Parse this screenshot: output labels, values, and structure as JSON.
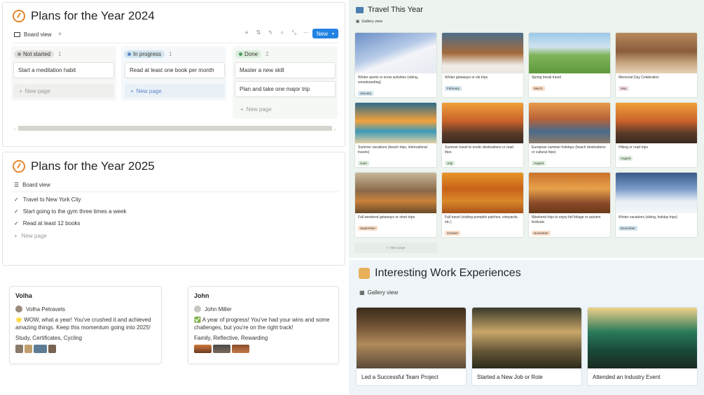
{
  "plans2024": {
    "title": "Plans for the Year 2024",
    "view_label": "Board view",
    "new_label": "New",
    "columns": [
      {
        "status": "Not started",
        "count": "1",
        "cards": [
          "Start a meditation habit"
        ],
        "new_page": "New page"
      },
      {
        "status": "In progress",
        "count": "1",
        "cards": [
          "Read at least one book per month"
        ],
        "new_page": "New page"
      },
      {
        "status": "Done",
        "count": "2",
        "cards": [
          "Master a new skill",
          "Plan and take one major trip"
        ],
        "new_page": "New page"
      }
    ]
  },
  "plans2025": {
    "title": "Plans for the Year 2025",
    "view_label": "Board view",
    "items": [
      "Travel to New York City",
      "Start going to the gym three times a week",
      "Read at least 12 books"
    ],
    "new_page": "New page"
  },
  "people": [
    {
      "title": "Volha",
      "user": "Volha Petravets",
      "emoji": "🌟",
      "message": "WOW, what a year! You've crushed it and achieved amazing things. Keep this momentum going into 2025!",
      "tags": "Study, Certificates, Cycling"
    },
    {
      "title": "John",
      "user": "John Miller",
      "emoji": "✅",
      "message": "A year of progress! You've had your wins and some challenges, but you're on the right track!",
      "tags": "Family, Reflective, Rewarding"
    }
  ],
  "travel": {
    "title": "Travel This Year",
    "view_label": "Gallery view",
    "new_page": "New page",
    "cards": [
      {
        "caption": "Winter sports or snow activities (skiing, snowboarding)",
        "month": "January"
      },
      {
        "caption": "Winter getaways or ski trips",
        "month": "February"
      },
      {
        "caption": "Spring break travel",
        "month": "March"
      },
      {
        "caption": "Memorial Day Celebration",
        "month": "May"
      },
      {
        "caption": "Summer vacations (beach trips, international travels)",
        "month": "June"
      },
      {
        "caption": "Summer travel to exotic destinations or road trips",
        "month": "July"
      },
      {
        "caption": "European summer holidays (beach destinations or cultural trips)",
        "month": "August"
      },
      {
        "caption": "Hiking or road trips",
        "month": "August"
      },
      {
        "caption": "Fall weekend getaways or short trips",
        "month": "September"
      },
      {
        "caption": "Fall travel (visiting pumpkin patches, vineyards, etc.)",
        "month": "October"
      },
      {
        "caption": "Weekend trips to enjoy fall foliage or autumn festivals",
        "month": "November"
      },
      {
        "caption": "Winter vacations (skiing, holiday trips)",
        "month": "December"
      }
    ]
  },
  "work": {
    "title": "Interesting Work Experiences",
    "view_label": "Gallery view",
    "cards": [
      {
        "caption": "Led a Successful Team Project"
      },
      {
        "caption": "Started a New Job or Role"
      },
      {
        "caption": "Attended an Industry Event"
      }
    ]
  }
}
